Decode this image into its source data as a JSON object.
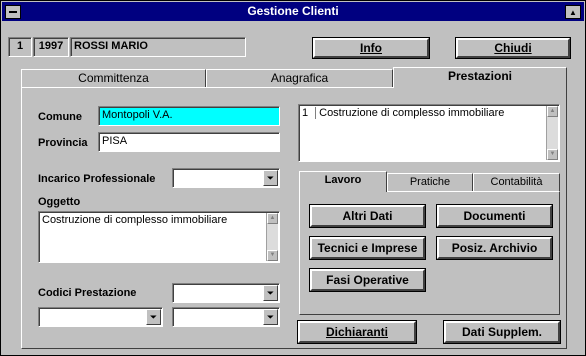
{
  "window": {
    "title": "Gestione Clienti"
  },
  "header": {
    "number": "1",
    "year": "1997",
    "client": "ROSSI MARIO",
    "info_label": "Info",
    "close_label": "Chiudi"
  },
  "main_tabs": [
    "Committenza",
    "Anagrafica",
    "Prestazioni"
  ],
  "form": {
    "comune_label": "Comune",
    "comune_value": "Montopoli V.A.",
    "provincia_label": "Provincia",
    "provincia_value": "PISA",
    "incarico_label": "Incarico Professionale",
    "incarico_value": "",
    "oggetto_label": "Oggetto",
    "oggetto_value": "Costruzione di complesso immobiliare",
    "codici_label": "Codici Prestazione"
  },
  "right": {
    "list_item_number": "1",
    "list_item_text": "Costruzione di complesso immobiliare",
    "subtabs": [
      "Lavoro",
      "Pratiche",
      "Contabilità"
    ],
    "buttons": {
      "altri_dati": "Altri Dati",
      "documenti": "Documenti",
      "tecnici": "Tecnici e Imprese",
      "posiz": "Posiz. Archivio",
      "fasi": "Fasi Operative"
    },
    "dichiaranti_label": "Dichiaranti",
    "dati_suppl_label": "Dati Supplem."
  },
  "colors": {
    "title_bg": "#000080",
    "comune_highlight": "#00ffff",
    "face": "#c0c0c0"
  },
  "icons": [
    "system-menu-icon",
    "maximize-icon",
    "combo-arrow-icon",
    "scroll-up-icon",
    "scroll-down-icon"
  ]
}
